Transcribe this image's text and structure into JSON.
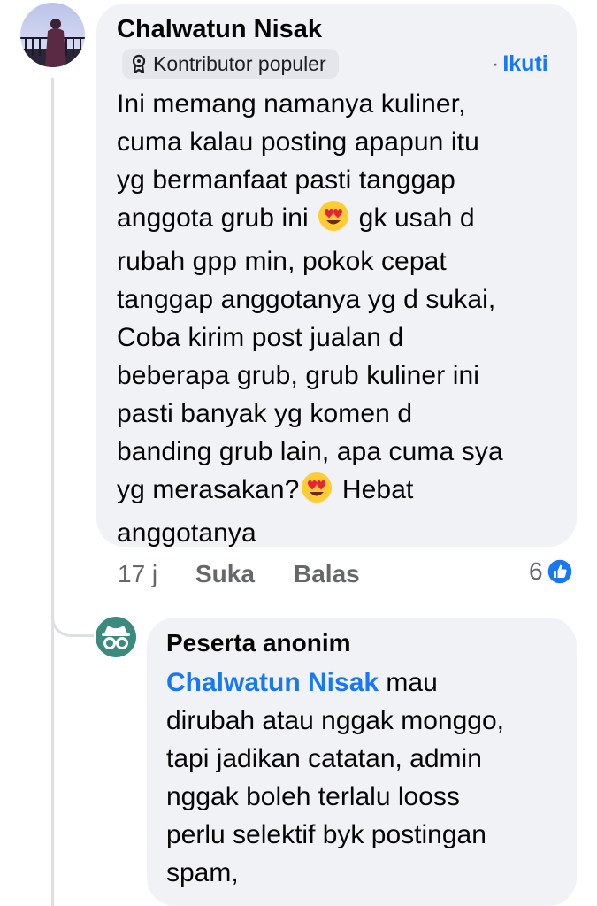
{
  "comment": {
    "author": "Chalwatun Nisak",
    "badge_icon": "badge-icon",
    "badge": "Kontributor populer",
    "follow_dot": "·",
    "follow_label": "Ikuti",
    "lines": [
      "Ini memang namanya kuliner,",
      "cuma kalau posting apapun itu",
      "yg bermanfaat pasti tanggap",
      "anggota grub ini",
      "gk usah d",
      "rubah gpp min, pokok cepat",
      "tanggap anggotanya yg d sukai,",
      "Coba kirim post jualan d",
      "beberapa grub, grub kuliner ini",
      "pasti banyak yg komen d",
      "banding grub lain, apa cuma sya",
      "yg merasakan?",
      "Hebat",
      "anggotanya"
    ],
    "emoji_name": "heart-eyes-emoji",
    "time": "17 j",
    "like_label": "Suka",
    "reply_label": "Balas",
    "reaction_count": "6",
    "reaction_icon": "like-icon",
    "accent_color": "#1877f2"
  },
  "reply": {
    "author": "Peserta anonim",
    "avatar_icon": "anonymous-icon",
    "mention": "Chalwatun Nisak",
    "lines": [
      "mau",
      "dirubah atau nggak monggo,",
      "tapi jadikan catatan, admin",
      "nggak boleh terlalu looss",
      "perlu selektif byk postingan",
      "spam,"
    ]
  }
}
